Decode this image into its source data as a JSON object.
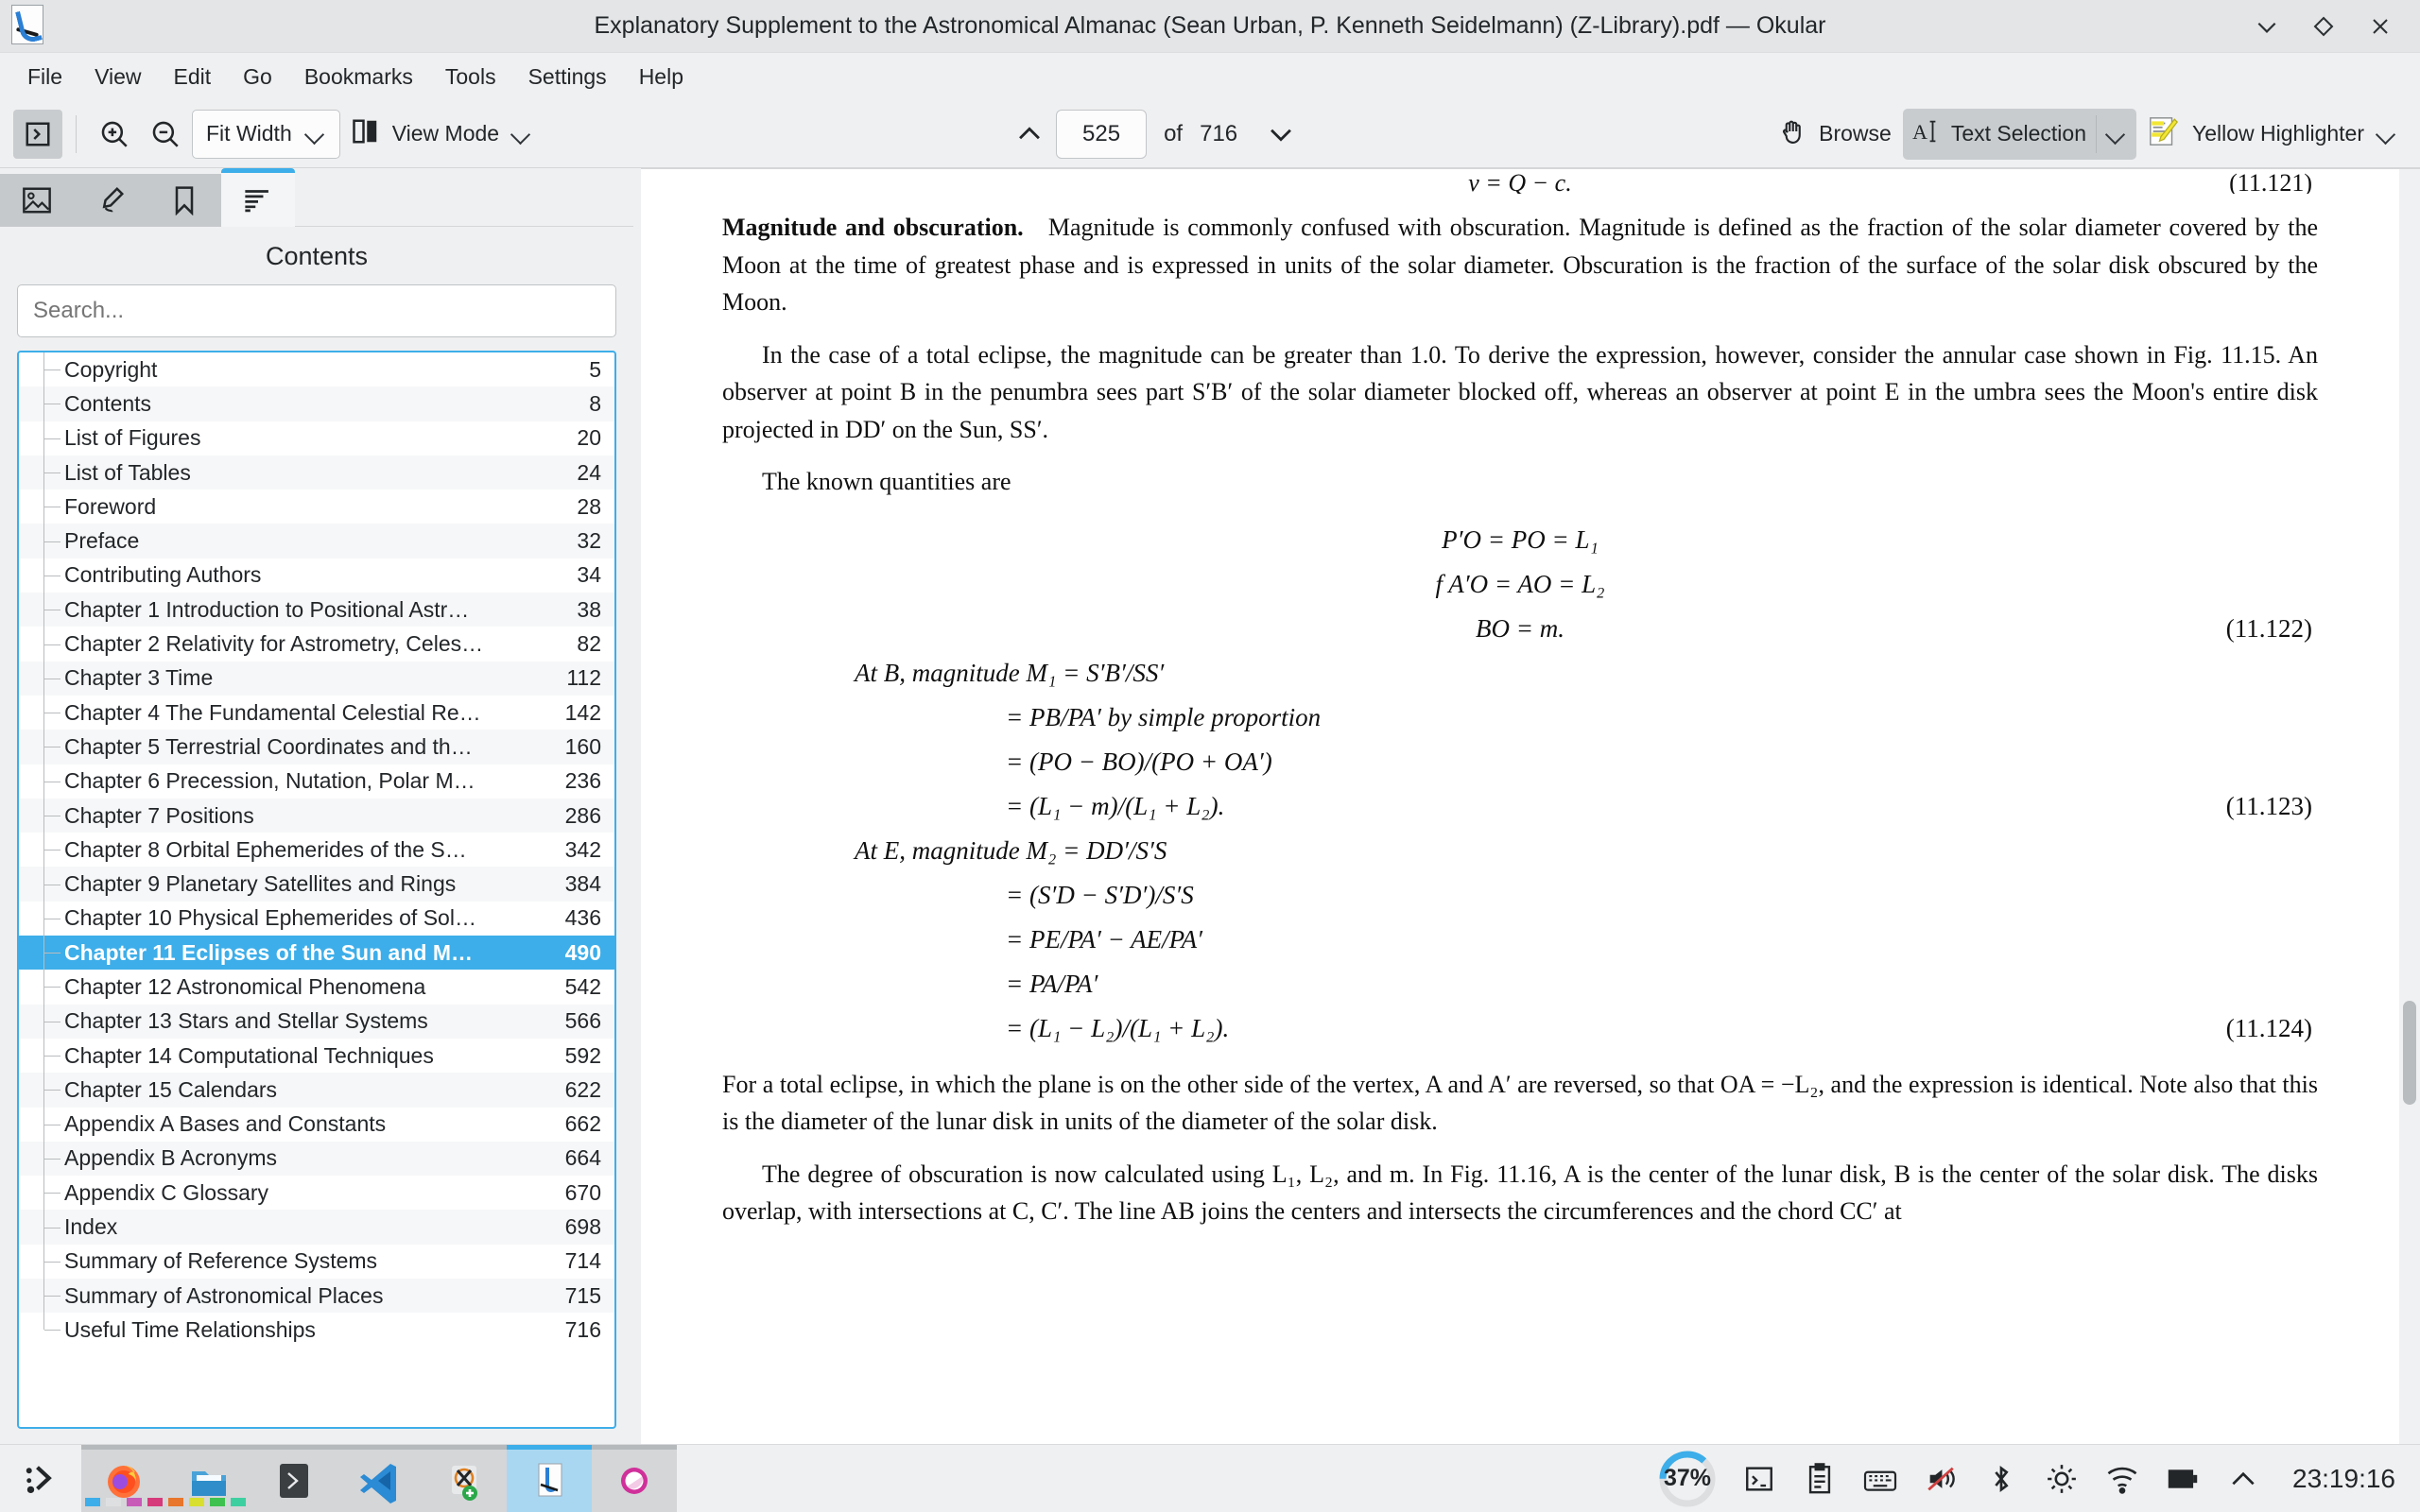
{
  "window": {
    "title": "Explanatory Supplement to the Astronomical Almanac (Sean Urban, P. Kenneth Seidelmann) (Z-Library).pdf — Okular",
    "app_icon": "okular-icon",
    "controls": {
      "minimize": "minimize",
      "maximize": "maximize",
      "close": "close"
    }
  },
  "menubar": {
    "items": [
      "File",
      "View",
      "Edit",
      "Go",
      "Bookmarks",
      "Tools",
      "Settings",
      "Help"
    ]
  },
  "toolbar": {
    "sidebar_toggle": "Show Sidebar",
    "zoom_in": "Zoom In",
    "zoom_out": "Zoom Out",
    "zoom_mode": "Fit Width",
    "view_mode": "View Mode",
    "prev_page": "Previous Page",
    "next_page": "Next Page",
    "page_current": "525",
    "page_of": "of",
    "page_total": "716",
    "browse": "Browse",
    "text_selection": "Text Selection",
    "highlighter": "Yellow Highlighter"
  },
  "sidebar": {
    "tabs": [
      {
        "name": "thumbnails",
        "label": "Thumbnails",
        "selected": false
      },
      {
        "name": "annotations",
        "label": "Annotations",
        "selected": false
      },
      {
        "name": "bookmarks",
        "label": "Bookmarks",
        "selected": false
      },
      {
        "name": "contents",
        "label": "Contents",
        "selected": true
      }
    ],
    "title": "Contents",
    "search_placeholder": "Search...",
    "search_value": "",
    "toc": [
      {
        "label": "Copyright",
        "page": "5",
        "selected": false
      },
      {
        "label": "Contents",
        "page": "8",
        "selected": false
      },
      {
        "label": "List of Figures",
        "page": "20",
        "selected": false
      },
      {
        "label": "List of Tables",
        "page": "24",
        "selected": false
      },
      {
        "label": "Foreword",
        "page": "28",
        "selected": false
      },
      {
        "label": "Preface",
        "page": "32",
        "selected": false
      },
      {
        "label": "Contributing Authors",
        "page": "34",
        "selected": false
      },
      {
        "label": "Chapter 1 Introduction to Positional Astr…",
        "page": "38",
        "selected": false
      },
      {
        "label": "Chapter 2 Relativity for Astrometry, Celes…",
        "page": "82",
        "selected": false
      },
      {
        "label": "Chapter 3 Time",
        "page": "112",
        "selected": false
      },
      {
        "label": "Chapter 4 The Fundamental Celestial Re…",
        "page": "142",
        "selected": false
      },
      {
        "label": "Chapter 5 Terrestrial Coordinates and th…",
        "page": "160",
        "selected": false
      },
      {
        "label": "Chapter 6 Precession, Nutation, Polar M…",
        "page": "236",
        "selected": false
      },
      {
        "label": "Chapter 7 Positions",
        "page": "286",
        "selected": false
      },
      {
        "label": "Chapter 8 Orbital Ephemerides of the S…",
        "page": "342",
        "selected": false
      },
      {
        "label": "Chapter 9 Planetary Satellites and Rings",
        "page": "384",
        "selected": false
      },
      {
        "label": "Chapter 10 Physical Ephemerides of Sol…",
        "page": "436",
        "selected": false
      },
      {
        "label": "Chapter 11 Eclipses of the Sun and M…",
        "page": "490",
        "selected": true
      },
      {
        "label": "Chapter 12 Astronomical Phenomena",
        "page": "542",
        "selected": false
      },
      {
        "label": "Chapter 13 Stars and Stellar Systems",
        "page": "566",
        "selected": false
      },
      {
        "label": "Chapter 14 Computational Techniques",
        "page": "592",
        "selected": false
      },
      {
        "label": "Chapter 15 Calendars",
        "page": "622",
        "selected": false
      },
      {
        "label": "Appendix A Bases and Constants",
        "page": "662",
        "selected": false
      },
      {
        "label": "Appendix B Acronyms",
        "page": "664",
        "selected": false
      },
      {
        "label": "Appendix C Glossary",
        "page": "670",
        "selected": false
      },
      {
        "label": "Index",
        "page": "698",
        "selected": false
      },
      {
        "label": "Summary of Reference Systems",
        "page": "714",
        "selected": false
      },
      {
        "label": "Summary of Astronomical Places",
        "page": "715",
        "selected": false
      },
      {
        "label": "Useful Time Relationships",
        "page": "716",
        "selected": false
      }
    ]
  },
  "document": {
    "eq_top": "v = Q − c.",
    "eq_top_num": "(11.121)",
    "para1_lead": "Magnitude and obscuration.",
    "para1": "Magnitude is commonly confused with obscuration. Magnitude is defined as the fraction of the solar diameter covered by the Moon at the time of greatest phase and is expressed in units of the solar diameter. Obscuration is the fraction of the surface of the solar disk obscured by the Moon.",
    "para2": "In the case of a total eclipse, the magnitude can be greater than 1.0. To derive the expression, however, consider the annular case shown in Fig. 11.15. An observer at point B in the penumbra sees part S′B′ of the solar diameter blocked off, whereas an observer at point E in the umbra sees the Moon's entire disk projected in DD′ on the Sun, SS′.",
    "para3": "The known quantities are",
    "eq_122_a": "P′O = PO = L₁",
    "eq_122_b": "f A′O = AO = L₂",
    "eq_122_c": "BO = m.",
    "eq_122_num": "(11.122)",
    "eq_123_a": "At B, magnitude M₁ = S′B′/SS′",
    "eq_123_b": "= PB/PA′ by simple proportion",
    "eq_123_c": "= (PO − BO)/(PO + OA′)",
    "eq_123_d": "= (L₁ − m)/(L₁ + L₂).",
    "eq_123_num": "(11.123)",
    "eq_124_a": "At E, magnitude M₂ = DD′/S′S",
    "eq_124_b": "= (S′D − S′D′)/S′S",
    "eq_124_c": "= PE/PA′ − AE/PA′",
    "eq_124_d": "= PA/PA′",
    "eq_124_e": "= (L₁ − L₂)/(L₁ + L₂).",
    "eq_124_num": "(11.124)",
    "para4": "For a total eclipse, in which the plane is on the other side of the vertex, A and A′ are reversed, so that OA = −L₂, and the expression is identical. Note also that this is the diameter of the lunar disk in units of the diameter of the solar disk.",
    "para5": "The degree of obscuration is now calculated using L₁, L₂, and m. In Fig. 11.16, A is the center of the lunar disk, B is the center of the solar disk. The disks overlap, with intersections at C, C′. The line AB joins the centers and intersects the circumferences and the chord CC′ at"
  },
  "taskbar": {
    "launcher": "application-launcher",
    "items": [
      {
        "name": "firefox",
        "label": "Firefox",
        "active": false
      },
      {
        "name": "file-manager",
        "label": "File Manager",
        "active": false
      },
      {
        "name": "terminal",
        "label": "Terminal",
        "active": false
      },
      {
        "name": "vscode",
        "label": "Visual Studio Code",
        "active": false
      },
      {
        "name": "xournal",
        "label": "Xournal++",
        "active": false
      },
      {
        "name": "okular",
        "label": "Okular",
        "active": true
      },
      {
        "name": "media-player",
        "label": "Media Player",
        "active": false
      }
    ],
    "battery_percent": "37%",
    "tray": [
      "terminal-tray-icon",
      "clipboard-icon",
      "keyboard-icon",
      "volume-muted-icon",
      "bluetooth-icon",
      "brightness-icon",
      "wifi-icon",
      "battery-icon",
      "show-hidden-icon"
    ],
    "clock": "23:19:16"
  },
  "colors": {
    "accent": "#3daee9",
    "window_bg": "#eff0f1",
    "titlebar_bg": "#e3e5e7",
    "text": "#232629"
  }
}
